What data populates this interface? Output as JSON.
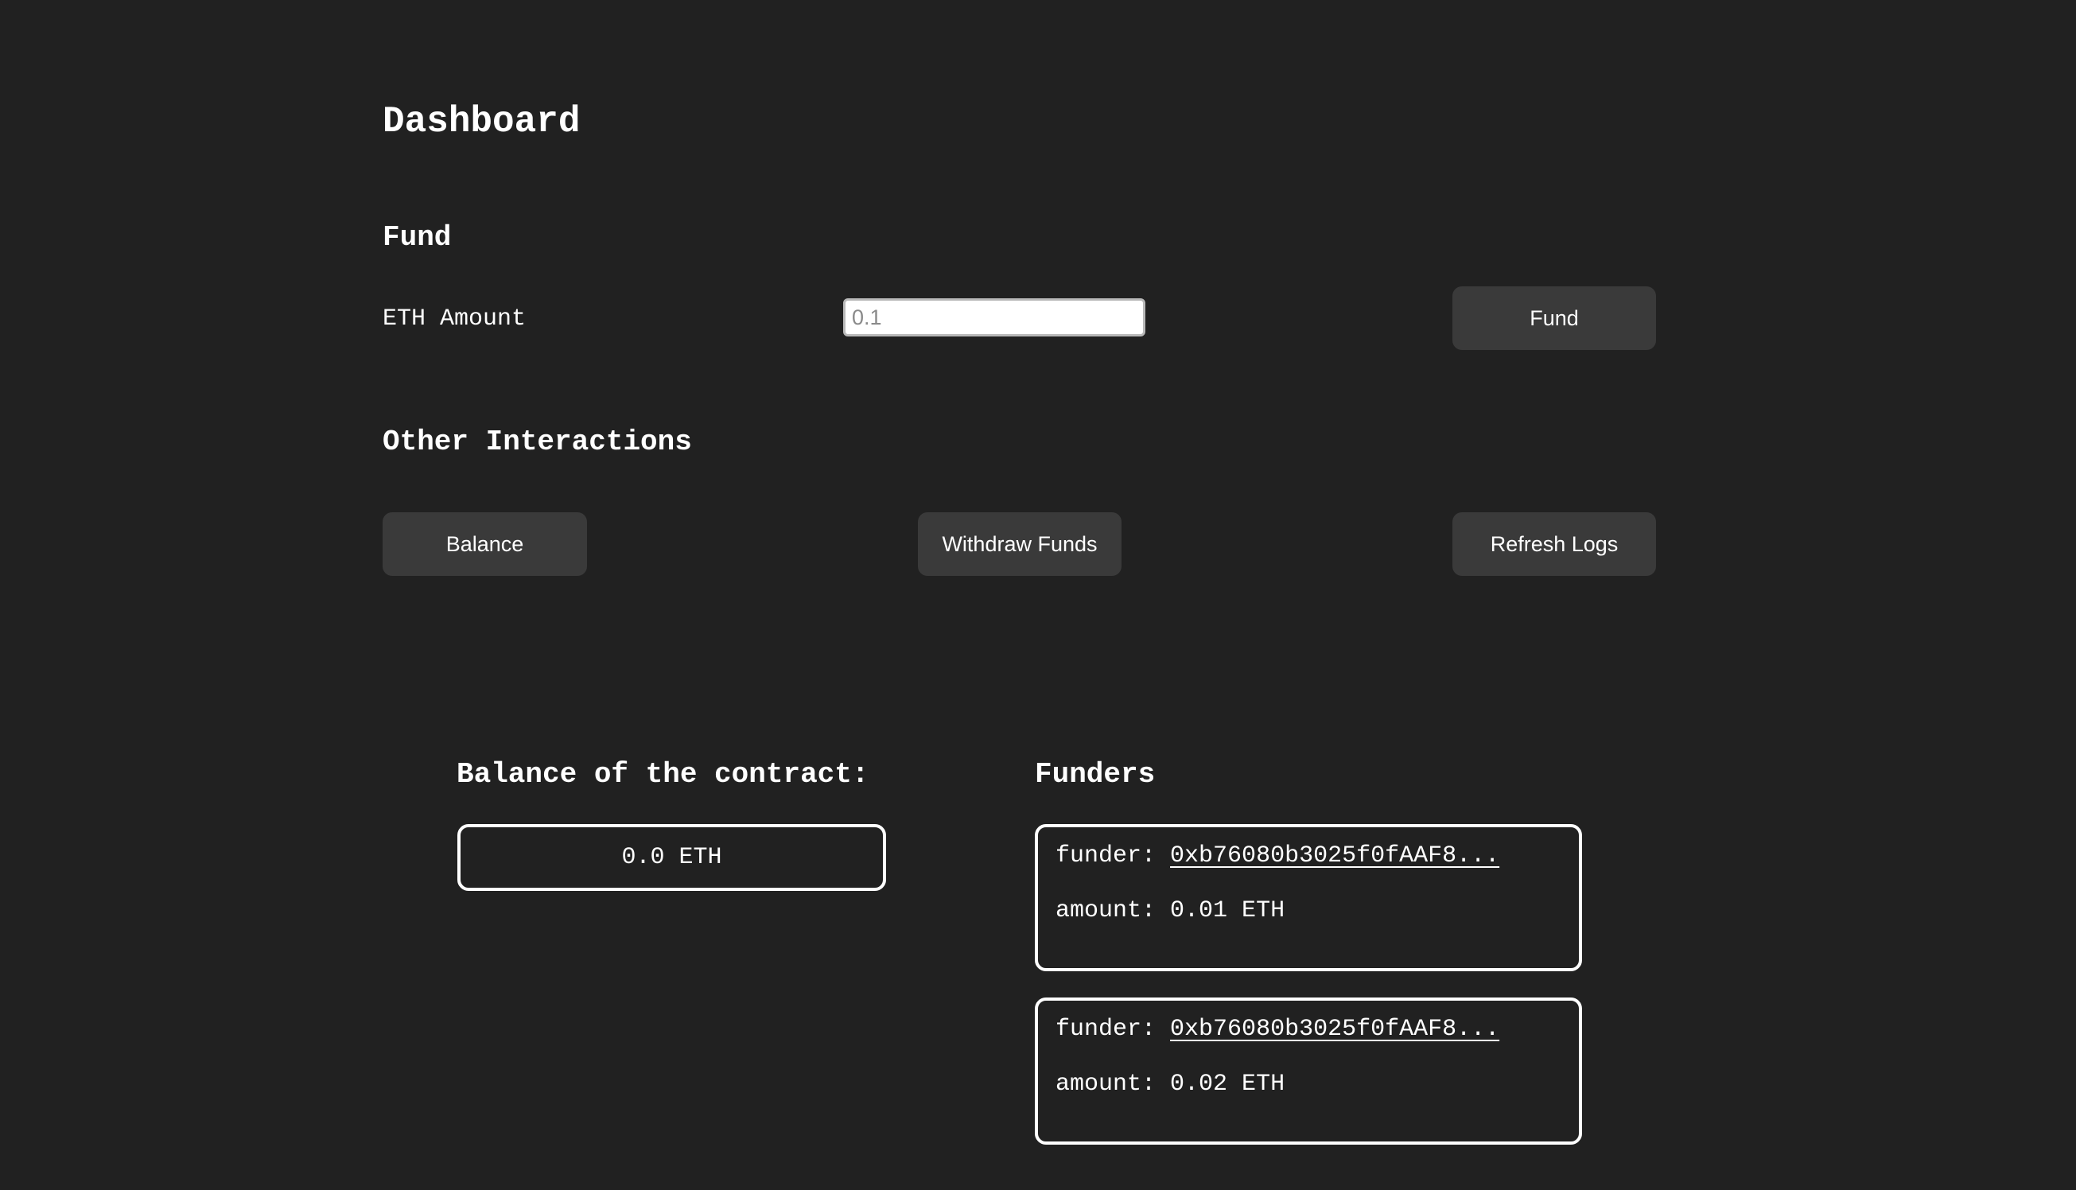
{
  "page_title": "Dashboard",
  "fund_section": {
    "heading": "Fund",
    "amount_label": "ETH Amount",
    "amount_placeholder": "0.1",
    "fund_button": "Fund"
  },
  "interactions_section": {
    "heading": "Other Interactions",
    "balance_button": "Balance",
    "withdraw_button": "Withdraw Funds",
    "refresh_button": "Refresh Logs"
  },
  "balance_section": {
    "heading": "Balance of the contract:",
    "value": "0.0 ETH"
  },
  "funders_section": {
    "heading": "Funders",
    "funder_label": "funder:",
    "amount_label": "amount:",
    "items": [
      {
        "address": "0xb76080b3025f0fAAF8...",
        "amount": "0.01 ETH"
      },
      {
        "address": "0xb76080b3025f0fAAF8...",
        "amount": "0.02 ETH"
      }
    ]
  }
}
